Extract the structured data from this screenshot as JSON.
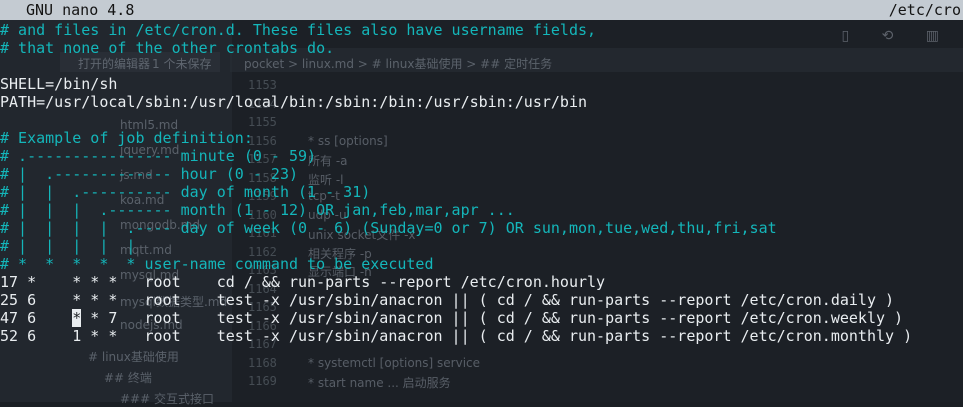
{
  "titlebar": {
    "app": "GNU nano 4.8",
    "file": "/etc/cro"
  },
  "colors": {
    "comment": "#14b6ba",
    "text": "#e9edf0",
    "titlebar_bg": "#c4cbd2"
  },
  "lines": [
    {
      "text": "# and files in /etc/cron.d. These files also have username fields,",
      "style": "comment"
    },
    {
      "text": "# that none of the other crontabs do.",
      "style": "comment"
    },
    {
      "text": "",
      "style": "text"
    },
    {
      "text": "SHELL=/bin/sh",
      "style": "text"
    },
    {
      "text": "PATH=/usr/local/sbin:/usr/local/bin:/sbin:/bin:/usr/sbin:/usr/bin",
      "style": "text"
    },
    {
      "text": "",
      "style": "text"
    },
    {
      "text": "# Example of job definition:",
      "style": "comment"
    },
    {
      "text": "# .---------------- minute (0 - 59)",
      "style": "comment"
    },
    {
      "text": "# |  .------------- hour (0 - 23)",
      "style": "comment"
    },
    {
      "text": "# |  |  .---------- day of month (1 - 31)",
      "style": "comment"
    },
    {
      "text": "# |  |  |  .------- month (1 - 12) OR jan,feb,mar,apr ...",
      "style": "comment"
    },
    {
      "text": "# |  |  |  |  .---- day of week (0 - 6) (Sunday=0 or 7) OR sun,mon,tue,wed,thu,fri,sat",
      "style": "comment"
    },
    {
      "text": "# |  |  |  |  |",
      "style": "comment"
    },
    {
      "text": "# *  *  *  *  * user-name command to be executed",
      "style": "comment"
    },
    {
      "text": "17 *    * * *   root    cd / && run-parts --report /etc/cron.hourly",
      "style": "text"
    },
    {
      "text": "25 6    * * *   root    test -x /usr/sbin/anacron || ( cd / && run-parts --report /etc/cron.daily )",
      "style": "text"
    },
    {
      "text_before": "47 6    ",
      "cursor_char": "*",
      "text_after": " * 7   root    test -x /usr/sbin/anacron || ( cd / && run-parts --report /etc/cron.weekly )",
      "style": "cursor"
    },
    {
      "text": "52 6    1 * *   root    test -x /usr/sbin/anacron || ( cd / && run-parts --report /etc/cron.monthly )",
      "style": "text"
    }
  ],
  "background_editor": {
    "breadcrumb": "pocket > linux.md > # linux基础使用 > ## 定时任务",
    "open_editors": "打开的编辑器",
    "unsaved": "1 个未保存",
    "files": [
      "html5.md",
      "jquery.md",
      "js.md",
      "koa.md",
      "mongodb.md",
      "mqtt.md",
      "mysql.md",
      "mysql数据类型.md",
      "nodejs.md"
    ],
    "outline": [
      "# linux基础使用",
      "## 终端",
      "### 交互式接口"
    ],
    "line_numbers": [
      "1153",
      "1154",
      "1155",
      "1156",
      "1157",
      "1158",
      "1159",
      "1160",
      "1161",
      "1162",
      "1163",
      "1164",
      "1165",
      "1166",
      "1167",
      "1168",
      "1169"
    ],
    "editor_lines": [
      "",
      "",
      "",
      "* ss [options]",
      "所有 -a",
      "监听 -l",
      "tcp -t",
      "udp -u",
      "unix socket文件 -x",
      "相关程序 -p",
      "显示端口 -n",
      "",
      "",
      "",
      "",
      "* systemctl [options] service",
      "* start name ... 启动服务"
    ]
  }
}
